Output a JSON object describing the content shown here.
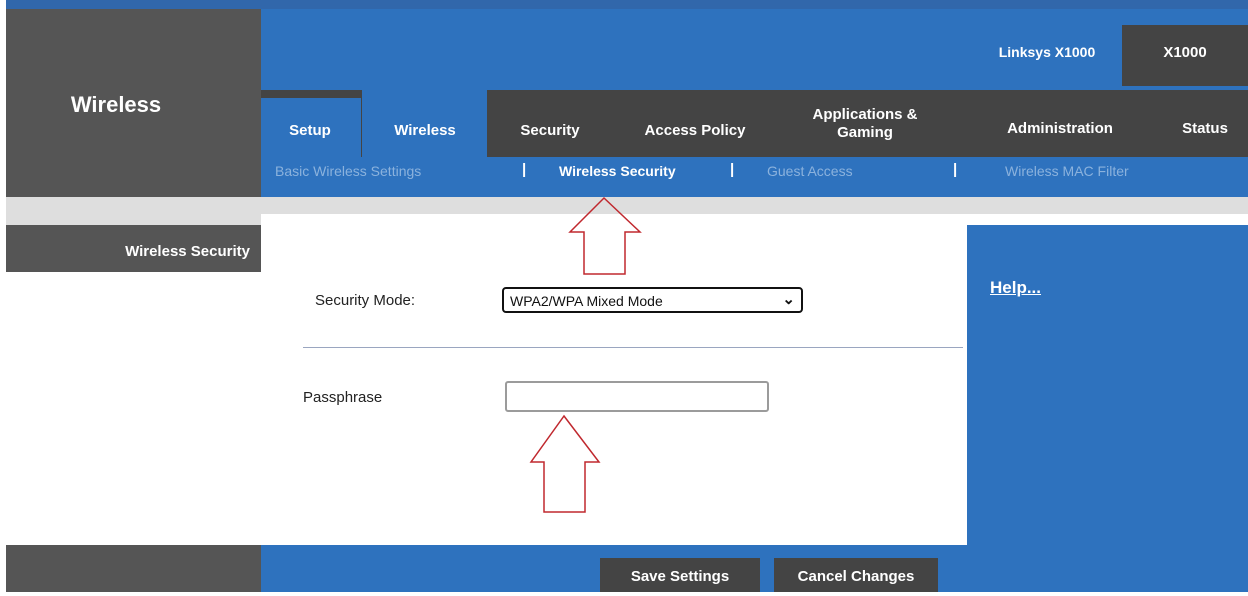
{
  "header": {
    "section_title": "Wireless",
    "model_label": "Linksys X1000",
    "model_id": "X1000"
  },
  "tabs": [
    {
      "label": "Setup"
    },
    {
      "label": "Wireless"
    },
    {
      "label": "Security"
    },
    {
      "label": "Access Policy"
    },
    {
      "label": "Applications &\nGaming"
    },
    {
      "label": "Administration"
    },
    {
      "label": "Status"
    }
  ],
  "subnav": {
    "items": [
      {
        "label": "Basic Wireless Settings"
      },
      {
        "label": "Wireless Security"
      },
      {
        "label": "Guest Access"
      },
      {
        "label": "Wireless MAC Filter"
      }
    ],
    "separator": "|"
  },
  "sidebar": {
    "label": "Wireless Security"
  },
  "form": {
    "security_mode_label": "Security Mode:",
    "security_mode_value": "WPA2/WPA Mixed Mode",
    "security_mode_arrow": "⌄",
    "passphrase_label": "Passphrase",
    "passphrase_value": ""
  },
  "help": {
    "link": "Help..."
  },
  "footer": {
    "save_label": "Save Settings",
    "cancel_label": "Cancel Changes"
  },
  "colors": {
    "brand_blue": "#2e72be",
    "dark_gray": "#444444",
    "annotation_red": "#c0282e"
  }
}
